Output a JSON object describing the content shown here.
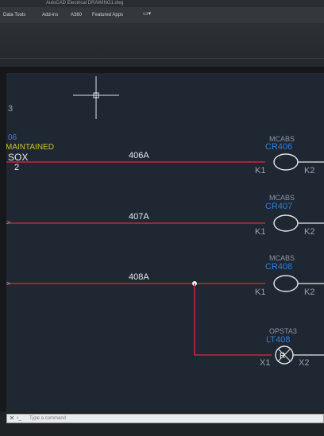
{
  "app": {
    "title": "AutoCAD Electrical   DRAWING1.dwg"
  },
  "menu": {
    "items": [
      "Data Tools",
      "Add-ins",
      "A360",
      "Featured Apps"
    ]
  },
  "command_line": {
    "prompt": "Type a command",
    "placeholder": ""
  },
  "drawing": {
    "edge_labels": {
      "line_number": "3",
      "text_blue": "06",
      "text_yellow": "MAINTAINED",
      "text_white": "SOX",
      "text_white_sub": "2"
    },
    "rungs": [
      {
        "wire": "406A",
        "component": {
          "part": "MCABS",
          "tag": "CR406",
          "pin_left": "K1",
          "pin_right": "K2",
          "type": "coil"
        }
      },
      {
        "wire": "407A",
        "component": {
          "part": "MCABS",
          "tag": "CR407",
          "pin_left": "K1",
          "pin_right": "K2",
          "type": "coil"
        }
      },
      {
        "wire": "408A",
        "component": {
          "part": "MCABS",
          "tag": "CR408",
          "pin_left": "K1",
          "pin_right": "K2",
          "type": "coil"
        }
      }
    ],
    "pilot_light": {
      "part": "OPSTA3",
      "tag": "LT408",
      "symbol": "R",
      "pin_left": "X1",
      "pin_right": "X2"
    },
    "colors": {
      "background": "#1f2733",
      "wire": "#c0283a",
      "tag_blue": "#2f7fd6",
      "part_gray": "#8c96a2",
      "text_white": "#e6e8ea",
      "text_yellow": "#c9c32b",
      "symbol_white": "#e6e8ea",
      "light_gray": "#9aa3ae"
    }
  }
}
